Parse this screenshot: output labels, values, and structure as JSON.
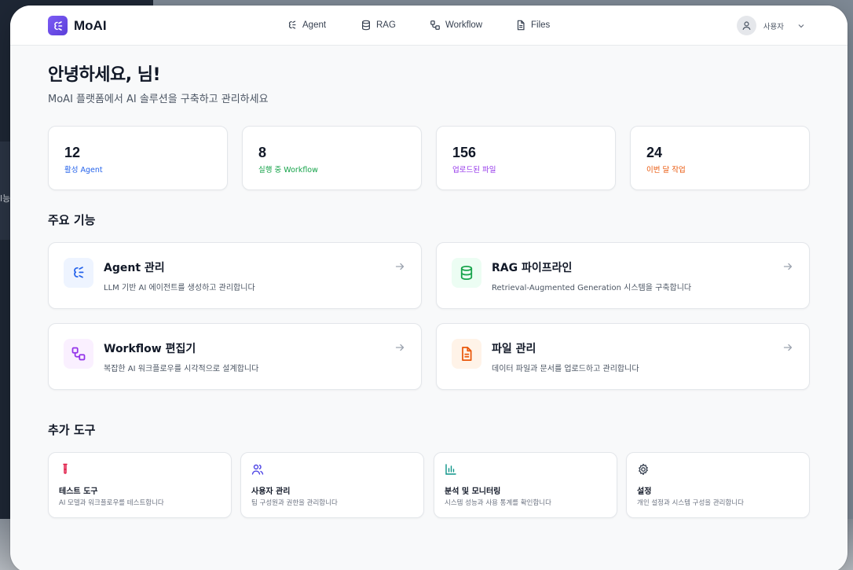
{
  "background": {
    "fragment_text": "l능"
  },
  "header": {
    "logo_text": "MoAI",
    "nav": [
      {
        "label": "Agent",
        "icon": "agent-icon"
      },
      {
        "label": "RAG",
        "icon": "database-icon"
      },
      {
        "label": "Workflow",
        "icon": "workflow-icon"
      },
      {
        "label": "Files",
        "icon": "file-icon"
      }
    ],
    "user_name": "사용자"
  },
  "welcome": {
    "title": "안녕하세요, 님!",
    "subtitle": "MoAI 플랫폼에서 AI 솔루션을 구축하고 관리하세요"
  },
  "stats": [
    {
      "value": "12",
      "label": "활성 Agent",
      "color": "#2563eb"
    },
    {
      "value": "8",
      "label": "실행 중 Workflow",
      "color": "#16a34a"
    },
    {
      "value": "156",
      "label": "업로드된 파일",
      "color": "#9333ea"
    },
    {
      "value": "24",
      "label": "이번 달 작업",
      "color": "#ea580c"
    }
  ],
  "features": {
    "title": "주요 기능",
    "items": [
      {
        "title": "Agent 관리",
        "desc": "LLM 기반 AI 에이전트를 생성하고 관리합니다",
        "icon": "agent-icon",
        "bg": "#eef4ff",
        "color": "#2563eb"
      },
      {
        "title": "RAG 파이프라인",
        "desc": "Retrieval-Augmented Generation 시스템을 구축합니다",
        "icon": "database-icon",
        "bg": "#ecfdf3",
        "color": "#16a34a"
      },
      {
        "title": "Workflow 편집기",
        "desc": "복잡한 AI 워크플로우를 시각적으로 설계합니다",
        "icon": "workflow-icon",
        "bg": "#faf0ff",
        "color": "#9333ea"
      },
      {
        "title": "파일 관리",
        "desc": "데이터 파일과 문서를 업로드하고 관리합니다",
        "icon": "file-icon",
        "bg": "#fff3e8",
        "color": "#ea580c"
      }
    ]
  },
  "tools": {
    "title": "추가 도구",
    "items": [
      {
        "title": "테스트 도구",
        "desc": "AI 모델과 워크플로우를 테스트합니다",
        "icon": "test-tube-icon",
        "color": "#e11d48"
      },
      {
        "title": "사용자 관리",
        "desc": "팀 구성원과 권한을 관리합니다",
        "icon": "users-icon",
        "color": "#4f46e5"
      },
      {
        "title": "분석 및 모니터링",
        "desc": "시스템 성능과 사용 통계를 확인합니다",
        "icon": "bar-chart-icon",
        "color": "#0d9488"
      },
      {
        "title": "설정",
        "desc": "개인 설정과 시스템 구성을 관리합니다",
        "icon": "gear-icon",
        "color": "#374151"
      }
    ]
  }
}
